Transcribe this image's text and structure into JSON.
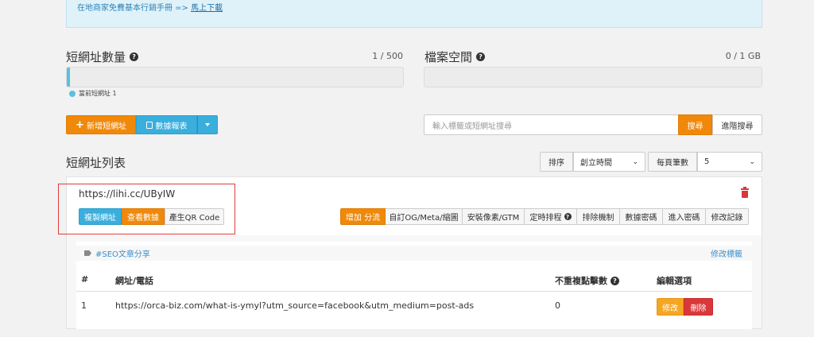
{
  "notice": {
    "text": "在地商家免費基本行銷手冊 => ",
    "link": "馬上下載"
  },
  "shorturl_count": {
    "title": "短網址數量",
    "count": "1 / 500",
    "legend": "當前短網址 1",
    "progress": 0.002
  },
  "file_space": {
    "title": "檔案空間",
    "count": "0 / 1 GB"
  },
  "toolbar": {
    "add_label": "新增短網址",
    "report_label": "數據報表"
  },
  "search": {
    "placeholder": "輸入標籤或短網址搜尋",
    "search_label": "搜尋",
    "advanced_label": "進階搜尋"
  },
  "list": {
    "title": "短網址列表",
    "sort_label": "排序",
    "sort_value": "創立時間",
    "per_page_label": "每頁筆數",
    "per_page_value": "5"
  },
  "item": {
    "short_url": "https://lihi.cc/UByIW",
    "copy_label": "複製網址",
    "view_label": "查看數據",
    "qr_label": "產生QR Code",
    "actions": [
      "增加 分流",
      "自訂OG/Meta/縮圖",
      "安裝像素/GTM",
      "定時排程",
      "排除機制",
      "數據密碼",
      "進入密碼",
      "修改記錄"
    ],
    "tag": "#SEO文章分享",
    "edit_tag_label": "修改標籤",
    "table": {
      "headers": {
        "num": "#",
        "url": "網址/電話",
        "clicks": "不重複點擊數",
        "options": "編輯選項"
      },
      "rows": [
        {
          "num": "1",
          "url": "https://orca-biz.com/what-is-ymyl?utm_source=facebook&utm_medium=post-ads",
          "clicks": "0",
          "edit": "修改",
          "delete": "刪除"
        }
      ]
    }
  }
}
